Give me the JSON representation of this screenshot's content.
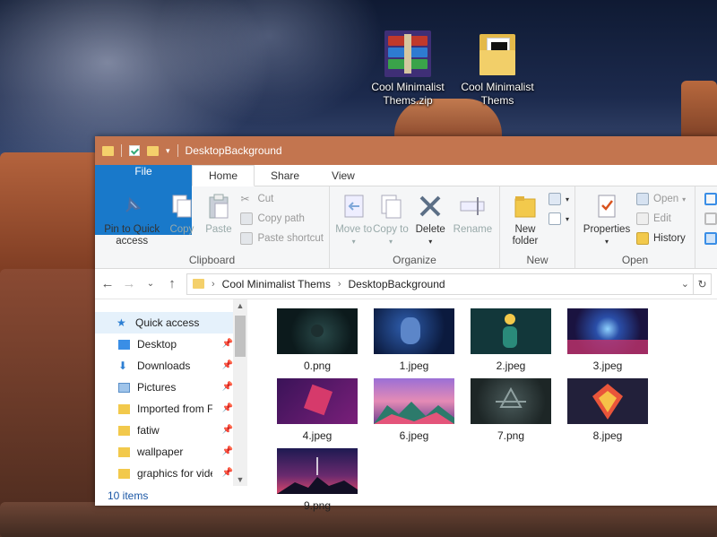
{
  "desktop": {
    "icons": [
      {
        "label": "Cool Minimalist Thems.zip",
        "icon": "winrar-archive-icon"
      },
      {
        "label": "Cool Minimalist Thems",
        "icon": "folder-icon"
      }
    ]
  },
  "window": {
    "title": "DesktopBackground",
    "titlebar_color": "#c3754f",
    "tabs": [
      "File",
      "Home",
      "Share",
      "View"
    ],
    "ribbon": {
      "clipboard": {
        "label": "Clipboard",
        "pin": "Pin to Quick access",
        "copy": "Copy",
        "paste": "Paste",
        "cut": "Cut",
        "copy_path": "Copy path",
        "paste_shortcut": "Paste shortcut"
      },
      "organize": {
        "label": "Organize",
        "move_to": "Move to",
        "copy_to": "Copy to",
        "delete": "Delete",
        "rename": "Rename"
      },
      "new": {
        "label": "New",
        "new_folder": "New folder"
      },
      "open": {
        "label": "Open",
        "properties": "Properties",
        "open": "Open",
        "edit": "Edit",
        "history": "History"
      }
    },
    "address": {
      "crumbs": [
        "Cool Minimalist Thems",
        "DesktopBackground"
      ]
    },
    "nav": {
      "quick_access": "Quick access",
      "items": [
        {
          "label": "Desktop",
          "icon": "desktop-folder-icon",
          "pinned": true
        },
        {
          "label": "Downloads",
          "icon": "downloads-folder-icon",
          "pinned": true
        },
        {
          "label": "Pictures",
          "icon": "pictures-folder-icon",
          "pinned": true
        },
        {
          "label": "Imported from F",
          "icon": "folder-icon",
          "pinned": true
        },
        {
          "label": "fatiw",
          "icon": "folder-icon",
          "pinned": true
        },
        {
          "label": "wallpaper",
          "icon": "folder-icon",
          "pinned": true
        },
        {
          "label": "graphics for vide",
          "icon": "folder-icon",
          "pinned": true
        }
      ]
    },
    "files": [
      {
        "name": "0.png"
      },
      {
        "name": "1.jpeg"
      },
      {
        "name": "2.jpeg"
      },
      {
        "name": "3.jpeg"
      },
      {
        "name": "4.jpeg"
      },
      {
        "name": "6.jpeg"
      },
      {
        "name": "7.png"
      },
      {
        "name": "8.jpeg"
      },
      {
        "name": "9.png"
      }
    ],
    "status": "10 items"
  }
}
